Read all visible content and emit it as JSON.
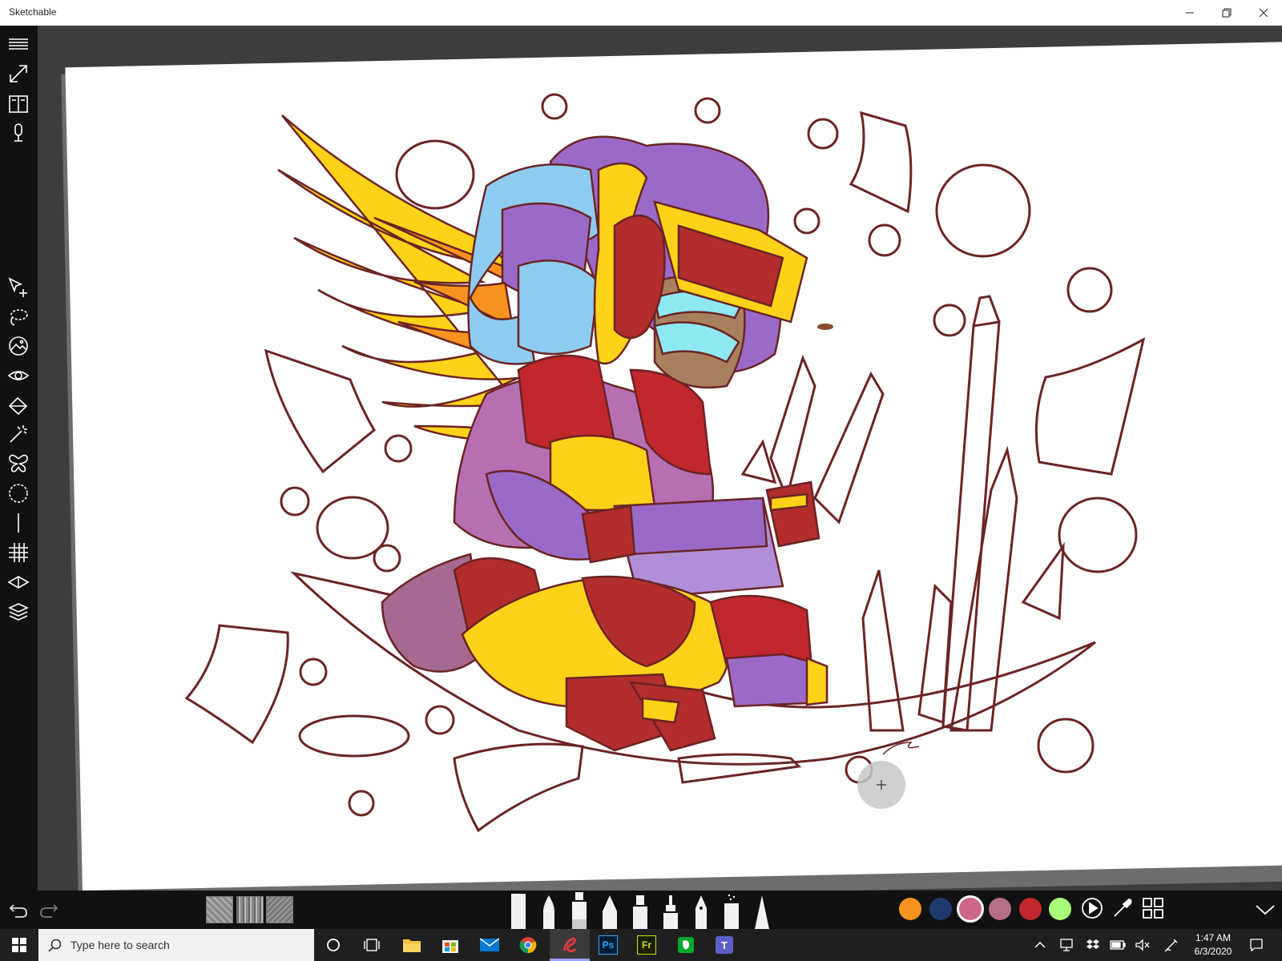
{
  "window": {
    "title": "Sketchable",
    "icons": [
      "minimize-icon",
      "restore-icon",
      "close-icon"
    ]
  },
  "left_toolbar": {
    "top_tools": [
      "menu-icon",
      "fullscreen-icon",
      "book-icon",
      "microphone-icon"
    ],
    "tools": [
      "select-move-icon",
      "lasso-icon",
      "image-insert-icon",
      "eye-icon",
      "fill-bucket-icon",
      "magic-wand-icon",
      "symmetry-icon",
      "circle-select-icon",
      "ruler-icon",
      "grid-icon",
      "perspective-icon",
      "layers-icon"
    ]
  },
  "bottom_toolbar": {
    "history": [
      "undo-icon",
      "redo-icon"
    ],
    "textures": [
      "texture-1",
      "texture-2",
      "texture-3"
    ],
    "brushes": [
      "marker-brush",
      "pen-brush",
      "ink-brush",
      "pencil-brush",
      "chisel-marker-brush",
      "technical-pen-brush",
      "fountain-pen-brush",
      "spray-brush",
      "cone-brush"
    ],
    "colors": [
      "#f7931e",
      "#1f3a6e",
      "#cc6688",
      "#b76f85",
      "#c1272d",
      "#a8ff7a"
    ],
    "selected_color_index": 2,
    "right_icons": [
      "play-icon",
      "eyedropper-icon",
      "grid-view-icon",
      "chevron-down-icon"
    ]
  },
  "taskbar": {
    "search_placeholder": "Type here to search",
    "apps": [
      "cortana-icon",
      "task-view-icon",
      "file-explorer-icon",
      "store-icon",
      "mail-icon",
      "chrome-icon",
      "sketchable-icon",
      "photoshop-icon",
      "fresco-icon",
      "evernote-icon",
      "teams-icon"
    ],
    "photoshop_label": "Ps",
    "fresco_label": "Fr",
    "teams_label": "T",
    "tray_icons": [
      "chevron-up-icon",
      "network-icon",
      "dropbox-icon",
      "battery-icon",
      "volume-muted-icon",
      "pen-icon"
    ],
    "time": "1:47 AM",
    "date": "6/3/2020",
    "notification_icon": "notification-icon"
  }
}
